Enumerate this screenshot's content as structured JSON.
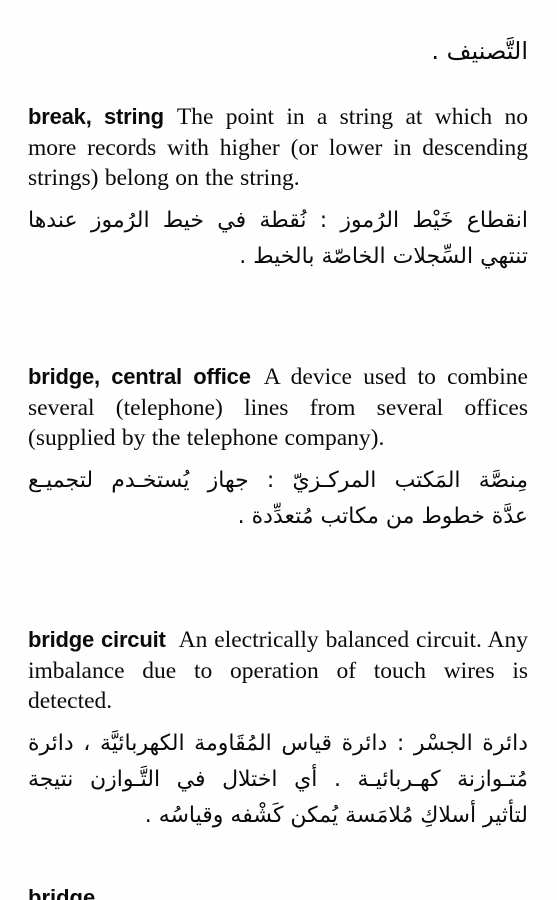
{
  "page": {
    "background_color": "#fefefe",
    "text_color": "#0a0a0a",
    "continuation_arabic": "التَّصنيف ."
  },
  "entries": [
    {
      "headword": "break, string",
      "definition_en": "The point in a string at which no more records with higher (or lower in descending strings) belong on the string.",
      "definition_ar_lines": [
        "انقطاع خَيْط الرُموز : نُقطة في خيط الرُموز عندها",
        "تنتهي السِّجلات الخاصّة بالخيط ."
      ]
    },
    {
      "headword": "bridge, central office",
      "definition_en": "A device used to combine several (telephone) lines from several offices (supplied by the telephone company).",
      "definition_ar_lines": [
        "مِنصَّة المَكتب المركـزيّ : جهاز يُستخـدم لتجميـع",
        "عدَّة خطوط من مكاتب مُتعدِّدة ."
      ]
    },
    {
      "headword": "bridge circuit",
      "definition_en": "An electrically balanced circuit. Any imbalance due to operation of touch wires is detected.",
      "definition_ar_lines": [
        "دائرة الجسْر : دائرة قياس المُقَاومة الكهربائيَّة ، دائرة",
        "مُتـوازنة كهـربائيـة . أي اختلال في التَّـوازن نتيجة",
        "لتأثير أسلاكِ مُلامَسة يُمكن كَشْفه وقياسُه ."
      ]
    }
  ],
  "cut_off_headword": "bridge, ..."
}
